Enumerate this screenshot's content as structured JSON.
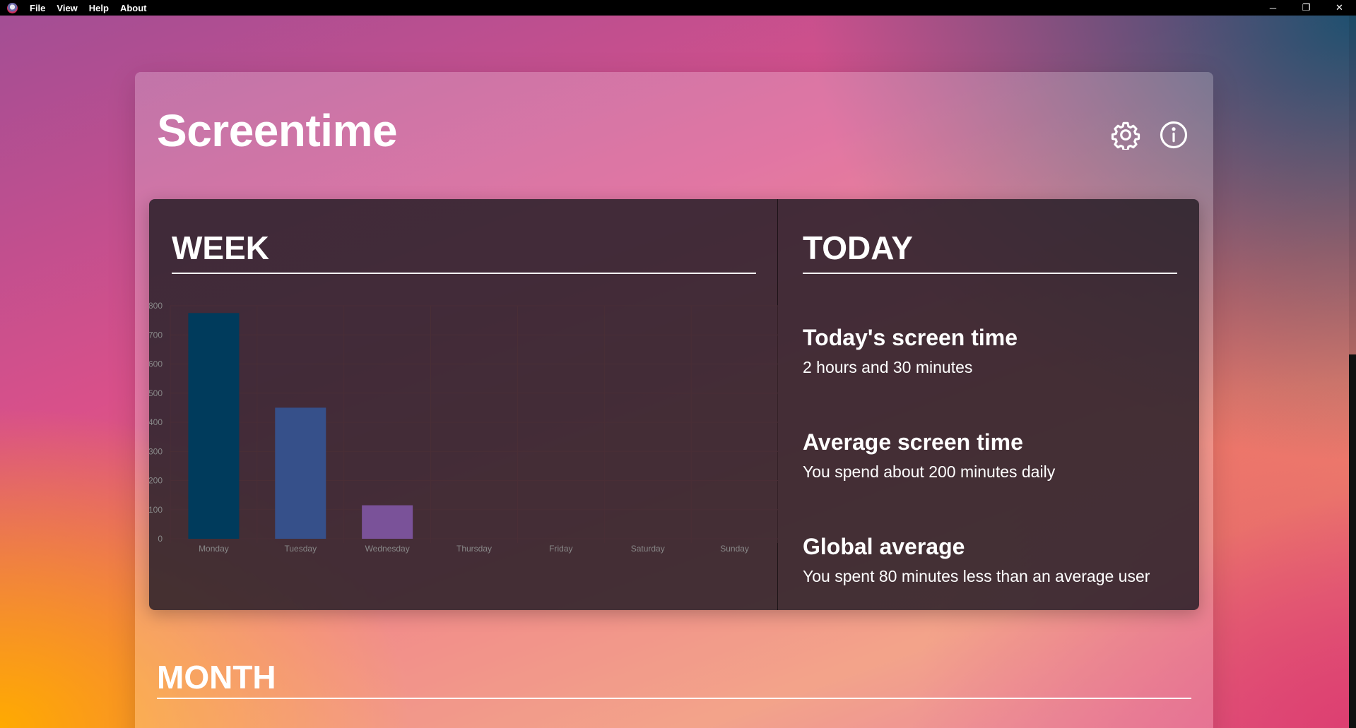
{
  "menu": {
    "items": [
      "File",
      "View",
      "Help",
      "About"
    ]
  },
  "window_controls": {
    "minimize": "─",
    "restore": "❐",
    "close": "✕"
  },
  "header": {
    "title": "Screentime",
    "icons": [
      "gear-icon",
      "info-icon"
    ]
  },
  "week": {
    "heading": "WEEK"
  },
  "today": {
    "heading": "TODAY",
    "stats": [
      {
        "title": "Today's screen time",
        "body": "2 hours and 30 minutes"
      },
      {
        "title": "Average screen time",
        "body": "You spend about 200 minutes daily"
      },
      {
        "title": "Global average",
        "body": "You spent 80 minutes less than an average user"
      }
    ]
  },
  "month": {
    "heading": "MONTH"
  },
  "colors": {
    "bar_monday": "#003b5c",
    "bar_tuesday": "#36508a",
    "bar_wednesday": "#7a5299",
    "grid": "#4a2e36",
    "tick": "#888888"
  },
  "chart_data": {
    "type": "bar",
    "categories": [
      "Monday",
      "Tuesday",
      "Wednesday",
      "Thursday",
      "Friday",
      "Saturday",
      "Sunday"
    ],
    "values": [
      775,
      450,
      115,
      0,
      0,
      0,
      0
    ],
    "yticks": [
      0,
      100,
      200,
      300,
      400,
      500,
      600,
      700,
      800
    ],
    "ylim": [
      0,
      800
    ],
    "grid": true,
    "legend": "none",
    "title": "",
    "xlabel": "",
    "ylabel": ""
  }
}
